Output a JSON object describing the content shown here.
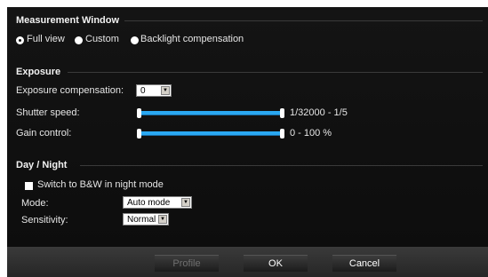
{
  "measurement": {
    "title": "Measurement Window",
    "options": [
      {
        "label": "Full view",
        "selected": true
      },
      {
        "label": "Custom",
        "selected": false
      },
      {
        "label": "Backlight compensation",
        "selected": false
      }
    ]
  },
  "exposure": {
    "title": "Exposure",
    "compensation_label": "Exposure compensation:",
    "compensation_value": "0",
    "shutter_label": "Shutter speed:",
    "shutter_range": "1/32000 - 1/5",
    "gain_label": "Gain control:",
    "gain_range": "0 - 100 %"
  },
  "daynight": {
    "title": "Day / Night",
    "bw_label": "Switch to B&W in night mode",
    "bw_checked": false,
    "mode_label": "Mode:",
    "mode_value": "Auto mode",
    "sensitivity_label": "Sensitivity:",
    "sensitivity_value": "Normal"
  },
  "footer": {
    "profile_label": "Profile",
    "ok_label": "OK",
    "cancel_label": "Cancel"
  },
  "colors": {
    "panel_bg": "#111111",
    "slider_accent": "#2aa8f2"
  }
}
